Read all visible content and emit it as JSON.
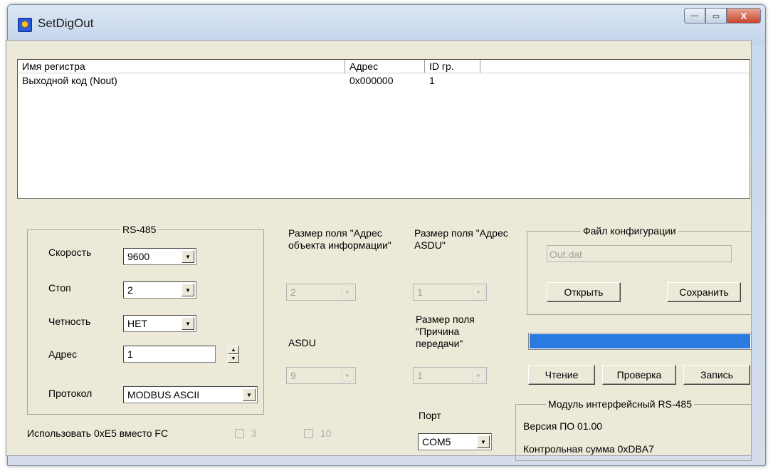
{
  "window": {
    "title": "SetDigOut",
    "buttons": {
      "minimize": "—",
      "maximize": "▭",
      "close": "X"
    }
  },
  "registers": {
    "columns": [
      "Имя регистра",
      "Адрес",
      "ID гр."
    ],
    "rows": [
      {
        "name": "Выходной код (Nout)",
        "address": "0x000000",
        "group_id": "1"
      }
    ]
  },
  "rs485": {
    "title": "RS-485",
    "speed": {
      "label": "Скорость",
      "value": "9600"
    },
    "stop": {
      "label": "Стоп",
      "value": "2"
    },
    "parity": {
      "label": "Четность",
      "value": "НЕТ"
    },
    "address": {
      "label": "Адрес",
      "value": "1"
    },
    "protocol": {
      "label": "Протокол",
      "value": "MODBUS ASCII"
    }
  },
  "iec": {
    "ioa_size": {
      "label": "Размер поля \"Адрес объекта информации\"",
      "value": "2"
    },
    "asdu_addr_size": {
      "label": "Размер поля \"Адрес ASDU\"",
      "value": "1"
    },
    "asdu": {
      "label": "ASDU",
      "value": "9"
    },
    "cause_size": {
      "label": "Размер поля \"Причина передачи\"",
      "value": "1"
    },
    "use_e5": {
      "label": "Использовать 0xE5 вместо FC",
      "opt1": "3",
      "opt2": "10"
    }
  },
  "port": {
    "label": "Порт",
    "value": "COM5"
  },
  "config_file": {
    "title": "Файл конфигурации",
    "filename": "Out.dat",
    "open": "Открыть",
    "save": "Сохранить"
  },
  "progress": {
    "value": 1.0,
    "color": "#2a7be0"
  },
  "actions": {
    "read": "Чтение",
    "verify": "Проверка",
    "write": "Запись"
  },
  "module": {
    "title": "Модуль интерфейсный RS-485",
    "version": "Версия ПО 01.00",
    "checksum": "Контрольная сумма 0xDBA7"
  }
}
